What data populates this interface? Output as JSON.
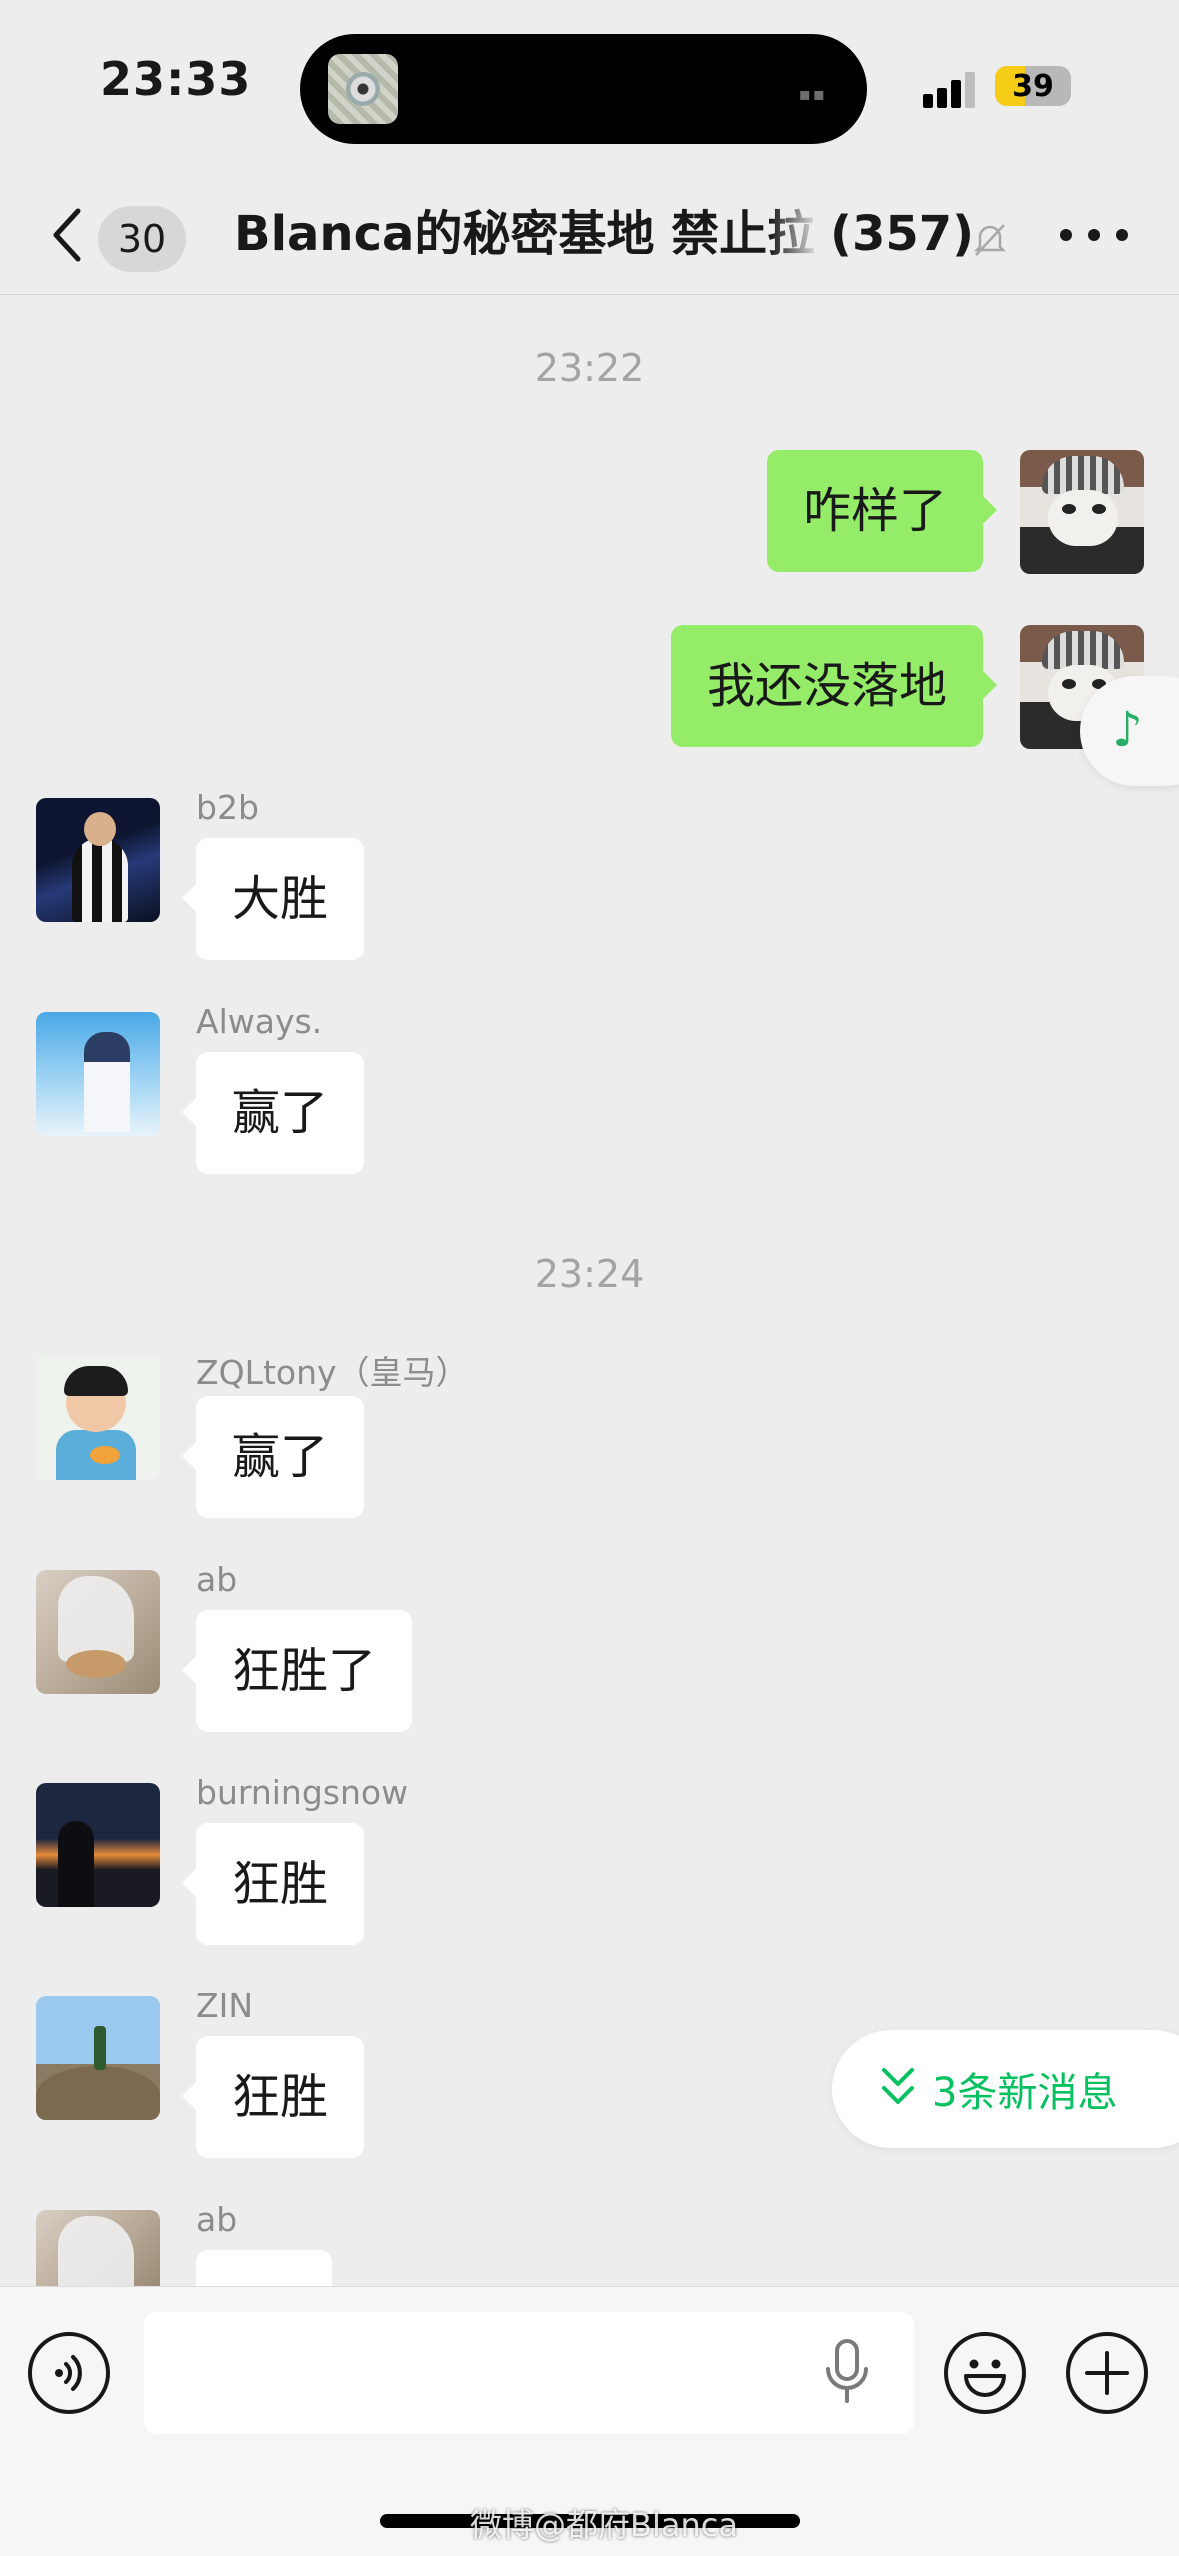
{
  "status_bar": {
    "time": "23:33",
    "battery": "39"
  },
  "nav": {
    "back_badge": "30",
    "title": "Blanca的秘密基地 禁止拉人",
    "member_count": "(357)"
  },
  "timestamps": [
    "23:22",
    "23:24"
  ],
  "messages": [
    {
      "side": "out",
      "text": "咋样了"
    },
    {
      "side": "out",
      "text": "我还没落地"
    },
    {
      "side": "in",
      "sender": "b2b",
      "text": "大胜"
    },
    {
      "side": "in",
      "sender": "Always.",
      "text": "赢了"
    },
    {
      "side": "in",
      "sender": "ZQLtony（皇马）",
      "text": "赢了"
    },
    {
      "side": "in",
      "sender": "ab",
      "text": "狂胜了"
    },
    {
      "side": "in",
      "sender": "burningsnow",
      "text": "狂胜"
    },
    {
      "side": "in",
      "sender": "ZIN",
      "text": "狂胜"
    },
    {
      "side": "in",
      "sender": "ab",
      "text": ""
    }
  ],
  "new_messages_label": "3条新消息",
  "input": {
    "placeholder": ""
  },
  "icons": {
    "back": "chevron-left-icon",
    "mute": "bell-slash-icon",
    "more": "more-dots-icon",
    "voice": "voice-icon",
    "mic": "microphone-icon",
    "emoji": "emoji-icon",
    "plus": "plus-icon",
    "music": "music-note-icon",
    "double_down": "double-chevron-down-icon"
  },
  "colors": {
    "bubble_out": "#95ec69",
    "accent": "#07c160",
    "background": "#ededed"
  },
  "watermark": "微博@都府Blanca"
}
